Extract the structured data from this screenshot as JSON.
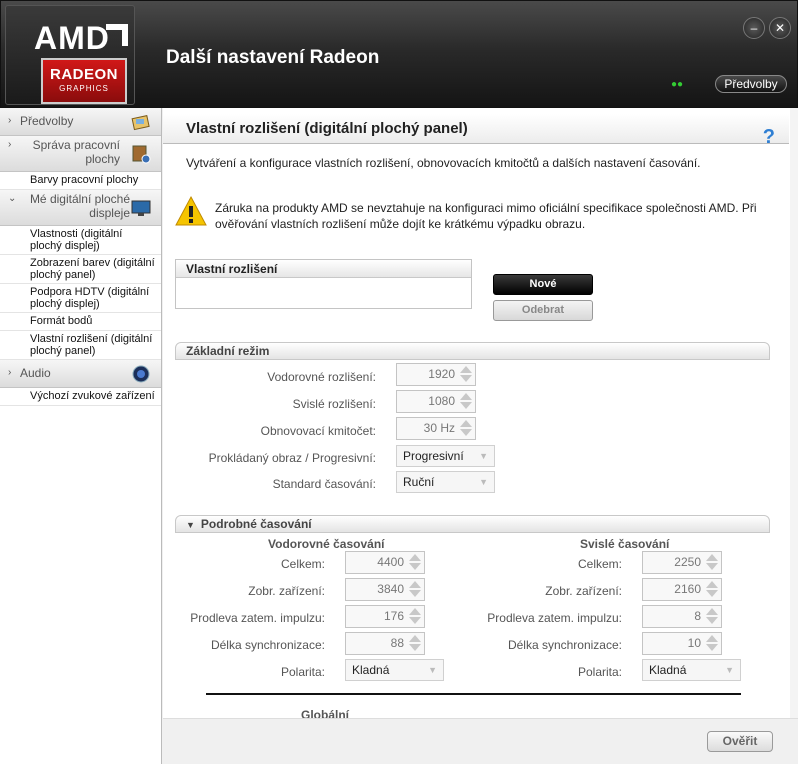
{
  "header": {
    "brand": "AMD",
    "badge_line1": "RADEON",
    "badge_line2": "GRAPHICS",
    "app_title": "Další nastavení Radeon",
    "minimize_label": "–",
    "close_label": "✕",
    "preferences_label": "Předvolby"
  },
  "sidebar": {
    "sections": [
      {
        "label": "Předvolby",
        "icon": "preferences-icon"
      },
      {
        "label": "Správa pracovní plochy",
        "icon": "desktop-management-icon",
        "items": [
          "Barvy pracovní plochy"
        ]
      },
      {
        "label": "Mé digitální ploché displeje",
        "icon": "monitor-icon",
        "items": [
          "Vlastnosti (digitální plochý displej)",
          "Zobrazení barev (digitální plochý panel)",
          "Podpora HDTV (digitální plochý displej)",
          "Formát bodů",
          "Vlastní rozlišení (digitální plochý panel)"
        ]
      },
      {
        "label": "Audio",
        "icon": "speaker-icon",
        "items": [
          "Výchozí zvukové zařízení"
        ]
      }
    ]
  },
  "page": {
    "title": "Vlastní rozlišení (digitální plochý panel)",
    "help": "?",
    "description": "Vytváření a konfigurace vlastních rozlišení, obnovovacích kmitočtů a dalších nastavení časování.",
    "warning": "Záruka na produkty AMD se nevztahuje na konfiguraci mimo oficiální specifikace společnosti AMD. Při ověřování vlastních rozlišení může dojít ke krátkému výpadku obrazu."
  },
  "custom_res": {
    "header": "Vlastní rozlišení",
    "new_label": "Nové",
    "remove_label": "Odebrat"
  },
  "basic_mode": {
    "header": "Základní režim",
    "horizontal_label": "Vodorovné rozlišení:",
    "horizontal_value": "1920",
    "vertical_label": "Svislé rozlišení:",
    "vertical_value": "1080",
    "refresh_label": "Obnovovací kmitočet:",
    "refresh_value": "30 Hz",
    "scan_label": "Prokládaný obraz / Progresivní:",
    "scan_value": "Progresivní",
    "timing_label": "Standard časování:",
    "timing_value": "Ruční"
  },
  "detailed": {
    "header": "Podrobné časování",
    "h_title": "Vodorovné časování",
    "v_title": "Svislé časování",
    "total_label": "Celkem:",
    "display_label": "Zobr. zařízení:",
    "porch_label": "Prodleva zatem. impulzu:",
    "sync_label": "Délka synchronizace:",
    "polarity_label": "Polarita:",
    "h": {
      "total": "4400",
      "display": "3840",
      "porch": "176",
      "sync": "88",
      "polarity": "Kladná"
    },
    "v": {
      "total": "2250",
      "display": "2160",
      "porch": "8",
      "sync": "10",
      "polarity": "Kladná"
    },
    "global_label": "Globální"
  },
  "footer": {
    "ok_label": "Ověřit"
  },
  "colors": {
    "accent_red": "#d11818",
    "help_blue": "#2f7fd3"
  }
}
